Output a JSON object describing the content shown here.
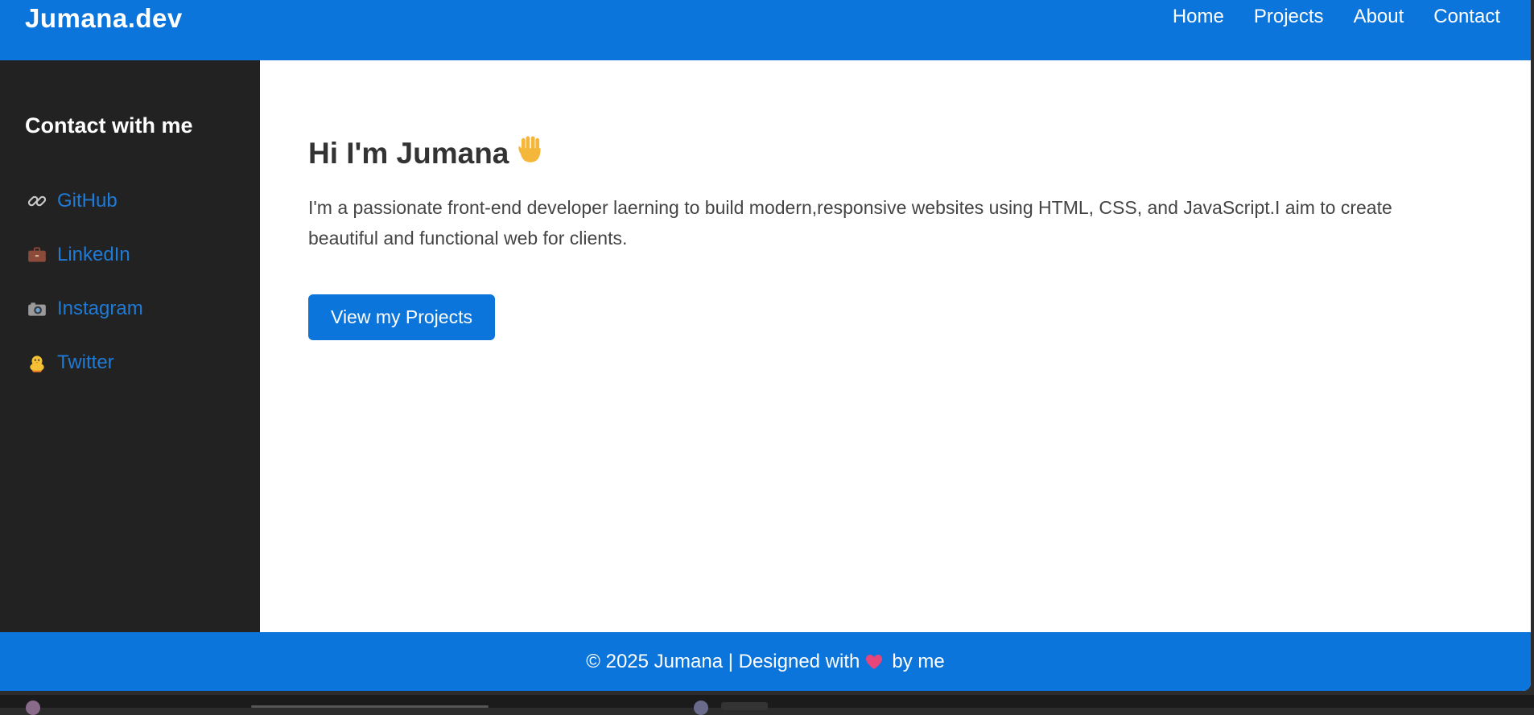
{
  "header": {
    "logo": "Jumana.dev",
    "nav": [
      "Home",
      "Projects",
      "About",
      "Contact"
    ]
  },
  "sidebar": {
    "title": "Contact with me",
    "links": [
      {
        "label": "GitHub",
        "icon": "link-icon"
      },
      {
        "label": "LinkedIn",
        "icon": "briefcase-icon"
      },
      {
        "label": "Instagram",
        "icon": "camera-icon"
      },
      {
        "label": "Twitter",
        "icon": "chick-icon"
      }
    ]
  },
  "main": {
    "title": "Hi I'm Jumana",
    "title_icon": "waving-hand-icon",
    "description": "I'm a passionate front-end developer laerning to build modern,responsive websites using HTML, CSS, and JavaScript.I aim to create beautiful and functional web for clients.",
    "cta_label": "View my Projects"
  },
  "footer": {
    "text_before": "© 2025 Jumana | Designed with",
    "heart_icon": "heart-icon",
    "text_after": "by me"
  },
  "colors": {
    "primary": "#0b75dc",
    "sidebar_bg": "#222222",
    "link": "#1f7bd6"
  }
}
